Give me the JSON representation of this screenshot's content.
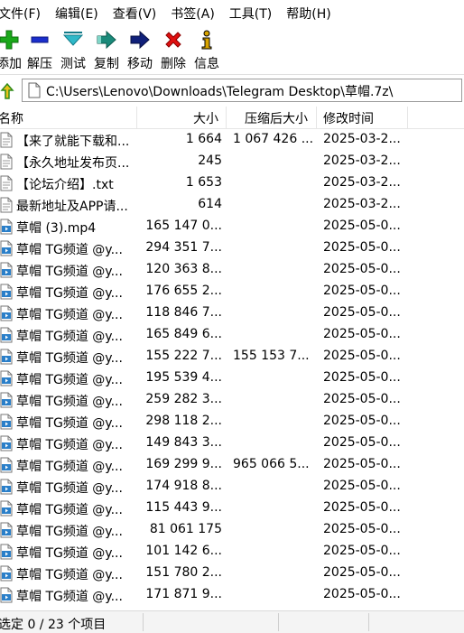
{
  "menu": [
    "文件(F)",
    "编辑(E)",
    "查看(V)",
    "书签(A)",
    "工具(T)",
    "帮助(H)"
  ],
  "toolbar": {
    "add": "添加",
    "extract": "解压",
    "test": "测试",
    "copy": "复制",
    "move": "移动",
    "delete": "删除",
    "info": "信息"
  },
  "address": "C:\\Users\\Lenovo\\Downloads\\Telegram Desktop\\草帽.7z\\",
  "columns": {
    "name": "名称",
    "size": "大小",
    "packed": "压缩后大小",
    "mtime": "修改时间"
  },
  "files": [
    {
      "name": "【来了就能下载和...",
      "size": "1 664",
      "packed": "1 067 426 ...",
      "mtime": "2025-03-2...",
      "type": "text"
    },
    {
      "name": "【永久地址发布页...",
      "size": "245",
      "packed": "",
      "mtime": "2025-03-2...",
      "type": "text"
    },
    {
      "name": "【论坛介绍】.txt",
      "size": "1 653",
      "packed": "",
      "mtime": "2025-03-2...",
      "type": "text"
    },
    {
      "name": "最新地址及APP请...",
      "size": "614",
      "packed": "",
      "mtime": "2025-03-2...",
      "type": "text"
    },
    {
      "name": "草帽 (3).mp4",
      "size": "165 147 0...",
      "packed": "",
      "mtime": "2025-05-0...",
      "type": "video"
    },
    {
      "name": "草帽 TG频道 @y...",
      "size": "294 351 7...",
      "packed": "",
      "mtime": "2025-05-0...",
      "type": "video"
    },
    {
      "name": "草帽 TG频道 @y...",
      "size": "120 363 8...",
      "packed": "",
      "mtime": "2025-05-0...",
      "type": "video"
    },
    {
      "name": "草帽 TG频道 @y...",
      "size": "176 655 2...",
      "packed": "",
      "mtime": "2025-05-0...",
      "type": "video"
    },
    {
      "name": "草帽 TG频道 @y...",
      "size": "118 846 7...",
      "packed": "",
      "mtime": "2025-05-0...",
      "type": "video"
    },
    {
      "name": "草帽 TG频道 @y...",
      "size": "165 849 6...",
      "packed": "",
      "mtime": "2025-05-0...",
      "type": "video"
    },
    {
      "name": "草帽 TG频道 @y...",
      "size": "155 222 7...",
      "packed": "155 153 7...",
      "mtime": "2025-05-0...",
      "type": "video"
    },
    {
      "name": "草帽 TG频道 @y...",
      "size": "195 539 4...",
      "packed": "",
      "mtime": "2025-05-0...",
      "type": "video"
    },
    {
      "name": "草帽 TG频道 @y...",
      "size": "259 282 3...",
      "packed": "",
      "mtime": "2025-05-0...",
      "type": "video"
    },
    {
      "name": "草帽 TG频道 @y...",
      "size": "298 118 2...",
      "packed": "",
      "mtime": "2025-05-0...",
      "type": "video"
    },
    {
      "name": "草帽 TG频道 @y...",
      "size": "149 843 3...",
      "packed": "",
      "mtime": "2025-05-0...",
      "type": "video"
    },
    {
      "name": "草帽 TG频道 @y...",
      "size": "169 299 9...",
      "packed": "965 066 5...",
      "mtime": "2025-05-0...",
      "type": "video"
    },
    {
      "name": "草帽 TG频道 @y...",
      "size": "174 918 8...",
      "packed": "",
      "mtime": "2025-05-0...",
      "type": "video"
    },
    {
      "name": "草帽 TG频道 @y...",
      "size": "115 443 9...",
      "packed": "",
      "mtime": "2025-05-0...",
      "type": "video"
    },
    {
      "name": "草帽 TG频道 @y...",
      "size": "81 061 175",
      "packed": "",
      "mtime": "2025-05-0...",
      "type": "video"
    },
    {
      "name": "草帽 TG频道 @y...",
      "size": "101 142 6...",
      "packed": "",
      "mtime": "2025-05-0...",
      "type": "video"
    },
    {
      "name": "草帽 TG频道 @y...",
      "size": "151 780 2...",
      "packed": "",
      "mtime": "2025-05-0...",
      "type": "video"
    },
    {
      "name": "草帽 TG频道 @y...",
      "size": "171 871 9...",
      "packed": "",
      "mtime": "2025-05-0...",
      "type": "video"
    }
  ],
  "status": "选定 0 / 23 个项目",
  "colors": {
    "add": "#1aa81a",
    "extract": "#1a2ecc",
    "test": "#2fb8c8",
    "copy": "#1a8a7a",
    "move": "#10207a",
    "delete": "#e01010",
    "info": "#d9a400"
  },
  "icons": {
    "add": "plus-icon",
    "extract": "minus-icon",
    "test": "check-chevron-icon",
    "copy": "arrow-right-icon",
    "move": "arrow-right-icon",
    "delete": "x-icon",
    "info": "info-icon"
  }
}
